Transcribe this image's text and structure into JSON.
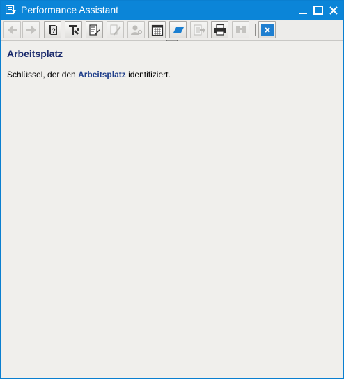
{
  "window": {
    "title": "Performance Assistant"
  },
  "toolbar": {
    "buttons": [
      {
        "name": "back-button",
        "icon": "arrow-left-icon",
        "enabled": false
      },
      {
        "name": "forward-button",
        "icon": "arrow-right-icon",
        "enabled": false
      },
      {
        "name": "help-book-button",
        "icon": "help-book-icon",
        "enabled": true
      },
      {
        "name": "technical-info-button",
        "icon": "tools-icon",
        "enabled": true
      },
      {
        "name": "edit-document-button",
        "icon": "edit-document-icon",
        "enabled": true
      },
      {
        "name": "edit-text-button",
        "icon": "pencil-icon",
        "enabled": false
      },
      {
        "name": "user-button",
        "icon": "user-key-icon",
        "enabled": false
      },
      {
        "name": "calendar-button",
        "icon": "calendar-icon",
        "enabled": true
      },
      {
        "name": "flag-button",
        "icon": "flag-icon",
        "enabled": true
      },
      {
        "name": "export-button",
        "icon": "export-icon",
        "enabled": false
      },
      {
        "name": "print-button",
        "icon": "printer-icon",
        "enabled": true
      },
      {
        "name": "binoculars-button",
        "icon": "binoculars-icon",
        "enabled": false
      },
      {
        "name": "close-help-button",
        "icon": "close-icon",
        "enabled": true
      }
    ]
  },
  "content": {
    "heading": "Arbeitsplatz",
    "text_before": "Schlüssel, der den ",
    "link_text": "Arbeitsplatz",
    "text_after": " identifiziert."
  },
  "colors": {
    "titlebar": "#0b85d8",
    "heading": "#1a2a6c",
    "link": "#1f3e8a",
    "background": "#f0efec"
  }
}
